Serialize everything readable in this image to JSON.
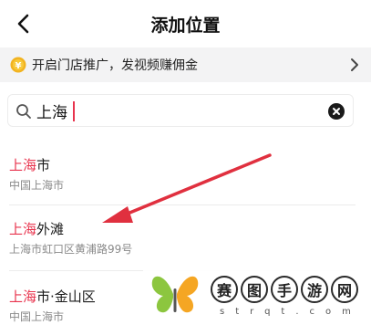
{
  "header": {
    "title": "添加位置"
  },
  "promo": {
    "text": "开启门店推广，发视频赚佣金"
  },
  "search": {
    "value": "上海"
  },
  "results": [
    {
      "highlight": "上海",
      "rest": "市",
      "address": "中国上海市"
    },
    {
      "highlight": "上海",
      "rest": "外滩",
      "address": "上海市虹口区黄浦路99号"
    },
    {
      "highlight": "上海",
      "rest": "市·金山区",
      "address": "中国上海市"
    }
  ],
  "watermark": {
    "chars": [
      "赛",
      "图",
      "手",
      "游",
      "网"
    ],
    "domain": "strqt.com"
  },
  "colors": {
    "highlight": "#e8344e",
    "arrow": "#e0303f",
    "banner_bg": "#f3f3f4"
  }
}
